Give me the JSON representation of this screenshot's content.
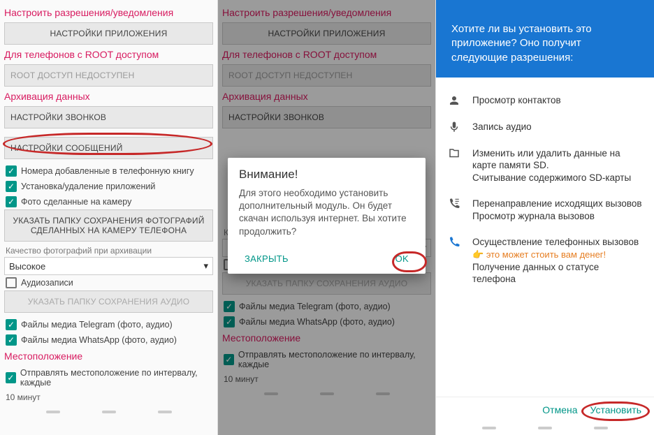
{
  "headings": {
    "permissions": "Настроить разрешения/уведомления",
    "root": "Для телефонов с ROOT доступом",
    "archive": "Архивация данных",
    "location": "Местоположение"
  },
  "buttons": {
    "app_settings": "НАСТРОЙКИ ПРИЛОЖЕНИЯ",
    "root_unavailable": "ROOT ДОСТУП НЕДОСТУПЕН",
    "call_settings": "НАСТРОЙКИ ЗВОНКОВ",
    "msg_settings": "НАСТРОЙКИ СООБЩЕНИЙ",
    "photo_folder": "УКАЗАТЬ ПАПКУ СОХРАНЕНИЯ ФОТОГРАФИЙ СДЕЛАННЫХ НА КАМЕРУ ТЕЛЕФОНА",
    "audio_folder": "УКАЗАТЬ ПАПКУ СОХРАНЕНИЯ АУДИО"
  },
  "checks": {
    "contacts": "Номера добавленные в телефонную книгу",
    "apps": "Установка/удаление приложений",
    "camera": "Фото сделанные на камеру",
    "audio": "Аудиозаписи",
    "telegram": "Файлы медиа Telegram (фото, аудио)",
    "whatsapp": "Файлы медиа WhatsApp (фото, аудио)",
    "location_interval": "Отправлять местоположение по интервалу, каждые"
  },
  "quality": {
    "label": "Качество фотографий при архивации",
    "value": "Высокое"
  },
  "interval": {
    "value": "10 минут"
  },
  "dialog": {
    "title": "Внимание!",
    "text": "Для этого необходимо установить дополнительный модуль. Он будет скачан используя интернет. Вы хотите продолжить?",
    "close": "ЗАКРЫТЬ",
    "ok": "OK"
  },
  "install": {
    "question": "Хотите ли вы установить это приложение? Оно получит следующие разрешения:",
    "perms": {
      "contacts": "Просмотр контактов",
      "audio": "Запись аудио",
      "sd1": "Изменить или удалить данные на карте памяти SD.",
      "sd2": "Считывание содержимого SD-карты",
      "call1": "Перенаправление исходящих вызовов",
      "call2": "Просмотр журнала вызовов",
      "phone1": "Осуществление телефонных вызовов",
      "phone_warn": "это может стоить вам денег!",
      "phone2": "Получение данных о статусе телефона"
    },
    "cancel": "Отмена",
    "install": "Установить"
  }
}
